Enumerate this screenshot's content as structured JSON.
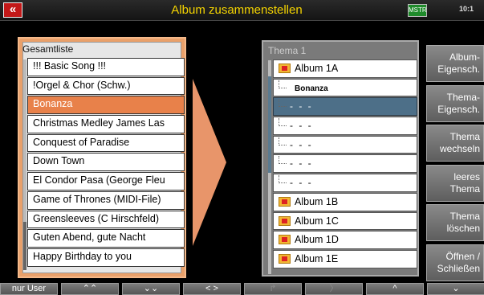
{
  "header": {
    "back_icon": "double-chevron-left-icon",
    "back_glyph": "«",
    "title": "Album zusammenstellen",
    "master_icon_label": "MSTR",
    "time": "10:1"
  },
  "left_panel": {
    "title": "Gesamtliste",
    "items": [
      "!!! Basic Song !!!",
      "!Orgel & Chor (Schw.)",
      "Bonanza",
      "Christmas Medley James Las",
      "Conquest of Paradise",
      "Down Town",
      "El Condor Pasa (George Fleu",
      "Game of Thrones (MIDI-File)",
      "Greensleeves (C Hirschfeld)",
      "Guten Abend, gute Nacht",
      "Happy Birthday to you"
    ],
    "selected_index": 2
  },
  "right_panel": {
    "title": "Thema 1",
    "rows": [
      {
        "type": "album",
        "label": "Album 1A"
      },
      {
        "type": "song",
        "label": "Bonanza"
      },
      {
        "type": "empty",
        "label": "- - -"
      },
      {
        "type": "empty",
        "label": "- - -"
      },
      {
        "type": "empty",
        "label": "- - -"
      },
      {
        "type": "empty",
        "label": "- - -"
      },
      {
        "type": "empty",
        "label": "- - -"
      },
      {
        "type": "album",
        "label": "Album 1B"
      },
      {
        "type": "album",
        "label": "Album 1C"
      },
      {
        "type": "album",
        "label": "Album 1D"
      },
      {
        "type": "album",
        "label": "Album 1E"
      }
    ],
    "selected_index": 2
  },
  "side_buttons": [
    {
      "label": "Album-\nEigensch."
    },
    {
      "label": "Thema-\nEigensch."
    },
    {
      "label": "Thema\nwechseln"
    },
    {
      "label": "leeres\nThema"
    },
    {
      "label": "Thema\nlöschen"
    },
    {
      "label": "Öffnen /\nSchließen"
    }
  ],
  "bottom_buttons": [
    {
      "label": "nur User",
      "dim": false
    },
    {
      "label": "⌃⌃",
      "dim": false
    },
    {
      "label": "⌄⌄",
      "dim": false
    },
    {
      "label": "< >",
      "dim": false
    },
    {
      "label": "↱",
      "dim": true
    },
    {
      "label": "〉",
      "dim": true
    },
    {
      "label": "^",
      "dim": false
    },
    {
      "label": "⌄",
      "dim": false
    }
  ],
  "colors": {
    "accent_orange": "#e8814a",
    "title_yellow": "#f5d400",
    "selected_blue": "#4d6f88"
  }
}
